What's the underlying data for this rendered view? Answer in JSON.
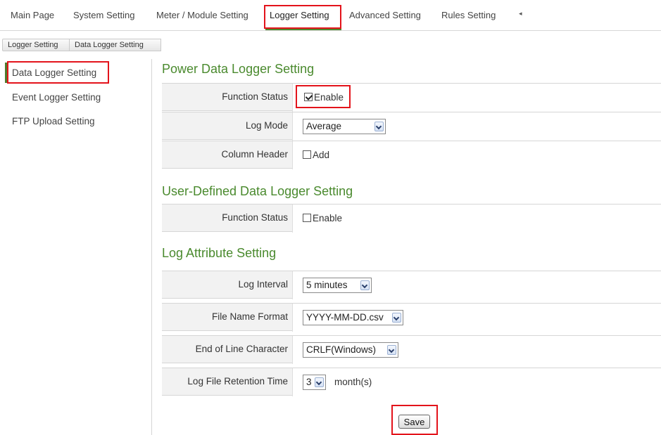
{
  "topnav": {
    "tabs": [
      "Main Page",
      "System Setting",
      "Meter / Module Setting",
      "Logger Setting",
      "Advanced Setting",
      "Rules Setting"
    ],
    "active": "Logger Setting",
    "scroll_arrow": "◂"
  },
  "breadcrumb": [
    "Logger Setting",
    "Data Logger Setting"
  ],
  "sidebar": {
    "items": [
      "Data Logger Setting",
      "Event Logger Setting",
      "FTP Upload Setting"
    ],
    "active": "Data Logger Setting"
  },
  "power_logger": {
    "title": "Power Data Logger Setting",
    "function_status_label": "Function Status",
    "function_status_option": "Enable",
    "function_status_checked": true,
    "log_mode_label": "Log Mode",
    "log_mode_value": "Average",
    "column_header_label": "Column Header",
    "column_header_option": "Add",
    "column_header_checked": false
  },
  "user_logger": {
    "title": "User-Defined Data Logger Setting",
    "function_status_label": "Function Status",
    "function_status_option": "Enable",
    "function_status_checked": false
  },
  "log_attribute": {
    "title": "Log Attribute Setting",
    "log_interval_label": "Log Interval",
    "log_interval_value": "5 minutes",
    "file_name_format_label": "File Name Format",
    "file_name_format_value": "YYYY-MM-DD.csv",
    "eol_label": "End of Line Character",
    "eol_value": "CRLF(Windows)",
    "retention_label": "Log File Retention Time",
    "retention_value": "3",
    "retention_unit": "month(s)"
  },
  "save_label": "Save",
  "colors": {
    "accent_green": "#4a8a2e",
    "highlight_red": "#e3131b",
    "row_bg": "#f2f2f2"
  }
}
